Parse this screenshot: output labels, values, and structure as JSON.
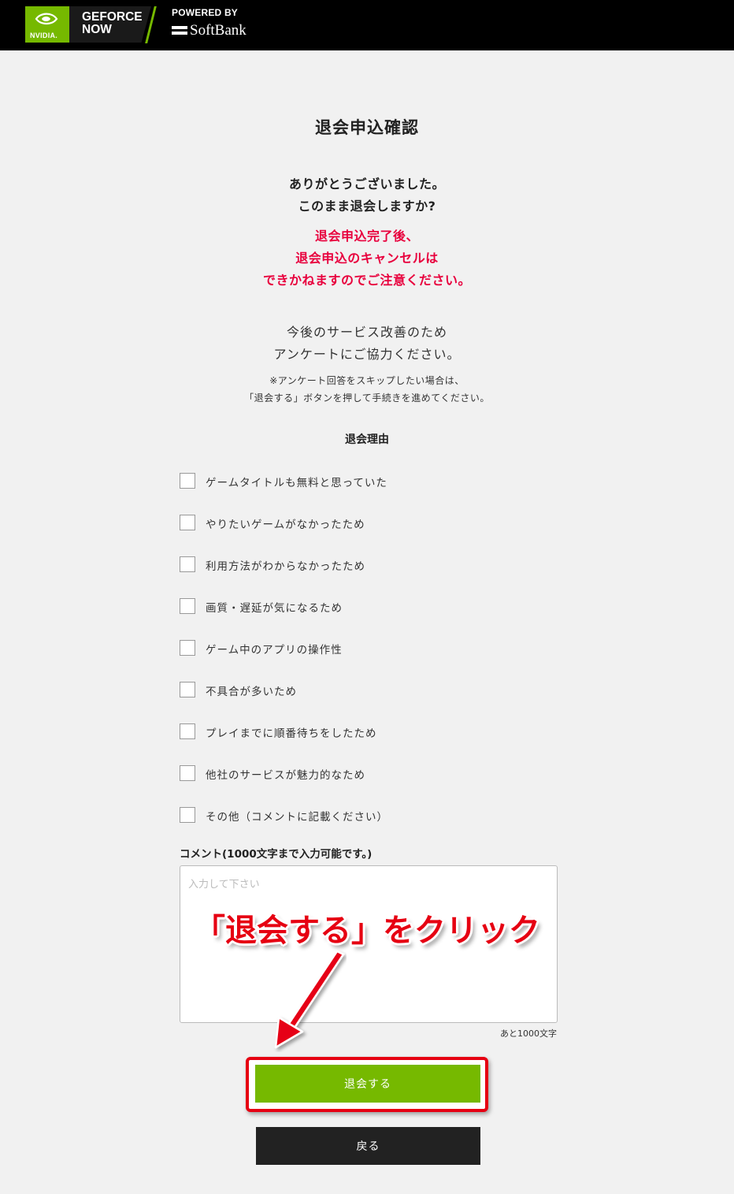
{
  "header": {
    "nvidia": "NVIDIA.",
    "geforce_line1": "GEFORCE",
    "geforce_line2": "NOW",
    "powered_by": "POWERED BY",
    "softbank": "SoftBank"
  },
  "page": {
    "title": "退会申込確認",
    "thanks_line1": "ありがとうございました。",
    "thanks_line2": "このまま退会しますか?",
    "warn_line1": "退会申込完了後、",
    "warn_line2": "退会申込のキャンセルは",
    "warn_line3": "できかねますのでご注意ください。",
    "survey_line1": "今後のサービス改善のため",
    "survey_line2": "アンケートにご協力ください。",
    "note_line1": "※アンケート回答をスキップしたい場合は、",
    "note_line2": "「退会する」ボタンを押して手続きを進めてください。",
    "reason_title": "退会理由"
  },
  "reasons": [
    "ゲームタイトルも無料と思っていた",
    "やりたいゲームがなかったため",
    "利用方法がわからなかったため",
    "画質・遅延が気になるため",
    "ゲーム中のアプリの操作性",
    "不具合が多いため",
    "プレイまでに順番待ちをしたため",
    "他社のサービスが魅力的なため",
    "その他（コメントに記載ください）"
  ],
  "comment": {
    "label": "コメント(1000文字まで入力可能です。)",
    "placeholder": "入力して下さい",
    "counter": "あと1000文字"
  },
  "annotation": "「退会する」をクリック",
  "buttons": {
    "withdraw": "退会する",
    "back": "戻る"
  },
  "colors": {
    "accent_green": "#76b900",
    "warning_red": "#e8003d",
    "annotation_red": "#e60012",
    "header_bg": "#000000",
    "back_button_bg": "#222222"
  }
}
